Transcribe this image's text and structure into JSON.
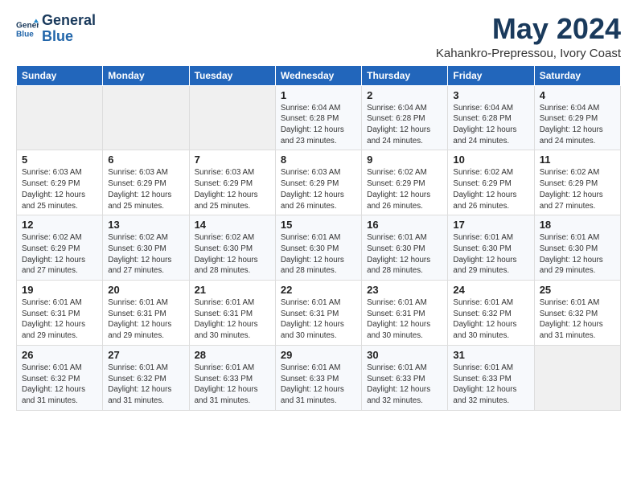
{
  "logo": {
    "line1": "General",
    "line2": "Blue"
  },
  "title": "May 2024",
  "subtitle": "Kahankro-Prepressou, Ivory Coast",
  "weekdays": [
    "Sunday",
    "Monday",
    "Tuesday",
    "Wednesday",
    "Thursday",
    "Friday",
    "Saturday"
  ],
  "weeks": [
    [
      {
        "day": "",
        "info": ""
      },
      {
        "day": "",
        "info": ""
      },
      {
        "day": "",
        "info": ""
      },
      {
        "day": "1",
        "info": "Sunrise: 6:04 AM\nSunset: 6:28 PM\nDaylight: 12 hours\nand 23 minutes."
      },
      {
        "day": "2",
        "info": "Sunrise: 6:04 AM\nSunset: 6:28 PM\nDaylight: 12 hours\nand 24 minutes."
      },
      {
        "day": "3",
        "info": "Sunrise: 6:04 AM\nSunset: 6:28 PM\nDaylight: 12 hours\nand 24 minutes."
      },
      {
        "day": "4",
        "info": "Sunrise: 6:04 AM\nSunset: 6:29 PM\nDaylight: 12 hours\nand 24 minutes."
      }
    ],
    [
      {
        "day": "5",
        "info": "Sunrise: 6:03 AM\nSunset: 6:29 PM\nDaylight: 12 hours\nand 25 minutes."
      },
      {
        "day": "6",
        "info": "Sunrise: 6:03 AM\nSunset: 6:29 PM\nDaylight: 12 hours\nand 25 minutes."
      },
      {
        "day": "7",
        "info": "Sunrise: 6:03 AM\nSunset: 6:29 PM\nDaylight: 12 hours\nand 25 minutes."
      },
      {
        "day": "8",
        "info": "Sunrise: 6:03 AM\nSunset: 6:29 PM\nDaylight: 12 hours\nand 26 minutes."
      },
      {
        "day": "9",
        "info": "Sunrise: 6:02 AM\nSunset: 6:29 PM\nDaylight: 12 hours\nand 26 minutes."
      },
      {
        "day": "10",
        "info": "Sunrise: 6:02 AM\nSunset: 6:29 PM\nDaylight: 12 hours\nand 26 minutes."
      },
      {
        "day": "11",
        "info": "Sunrise: 6:02 AM\nSunset: 6:29 PM\nDaylight: 12 hours\nand 27 minutes."
      }
    ],
    [
      {
        "day": "12",
        "info": "Sunrise: 6:02 AM\nSunset: 6:29 PM\nDaylight: 12 hours\nand 27 minutes."
      },
      {
        "day": "13",
        "info": "Sunrise: 6:02 AM\nSunset: 6:30 PM\nDaylight: 12 hours\nand 27 minutes."
      },
      {
        "day": "14",
        "info": "Sunrise: 6:02 AM\nSunset: 6:30 PM\nDaylight: 12 hours\nand 28 minutes."
      },
      {
        "day": "15",
        "info": "Sunrise: 6:01 AM\nSunset: 6:30 PM\nDaylight: 12 hours\nand 28 minutes."
      },
      {
        "day": "16",
        "info": "Sunrise: 6:01 AM\nSunset: 6:30 PM\nDaylight: 12 hours\nand 28 minutes."
      },
      {
        "day": "17",
        "info": "Sunrise: 6:01 AM\nSunset: 6:30 PM\nDaylight: 12 hours\nand 29 minutes."
      },
      {
        "day": "18",
        "info": "Sunrise: 6:01 AM\nSunset: 6:30 PM\nDaylight: 12 hours\nand 29 minutes."
      }
    ],
    [
      {
        "day": "19",
        "info": "Sunrise: 6:01 AM\nSunset: 6:31 PM\nDaylight: 12 hours\nand 29 minutes."
      },
      {
        "day": "20",
        "info": "Sunrise: 6:01 AM\nSunset: 6:31 PM\nDaylight: 12 hours\nand 29 minutes."
      },
      {
        "day": "21",
        "info": "Sunrise: 6:01 AM\nSunset: 6:31 PM\nDaylight: 12 hours\nand 30 minutes."
      },
      {
        "day": "22",
        "info": "Sunrise: 6:01 AM\nSunset: 6:31 PM\nDaylight: 12 hours\nand 30 minutes."
      },
      {
        "day": "23",
        "info": "Sunrise: 6:01 AM\nSunset: 6:31 PM\nDaylight: 12 hours\nand 30 minutes."
      },
      {
        "day": "24",
        "info": "Sunrise: 6:01 AM\nSunset: 6:32 PM\nDaylight: 12 hours\nand 30 minutes."
      },
      {
        "day": "25",
        "info": "Sunrise: 6:01 AM\nSunset: 6:32 PM\nDaylight: 12 hours\nand 31 minutes."
      }
    ],
    [
      {
        "day": "26",
        "info": "Sunrise: 6:01 AM\nSunset: 6:32 PM\nDaylight: 12 hours\nand 31 minutes."
      },
      {
        "day": "27",
        "info": "Sunrise: 6:01 AM\nSunset: 6:32 PM\nDaylight: 12 hours\nand 31 minutes."
      },
      {
        "day": "28",
        "info": "Sunrise: 6:01 AM\nSunset: 6:33 PM\nDaylight: 12 hours\nand 31 minutes."
      },
      {
        "day": "29",
        "info": "Sunrise: 6:01 AM\nSunset: 6:33 PM\nDaylight: 12 hours\nand 31 minutes."
      },
      {
        "day": "30",
        "info": "Sunrise: 6:01 AM\nSunset: 6:33 PM\nDaylight: 12 hours\nand 32 minutes."
      },
      {
        "day": "31",
        "info": "Sunrise: 6:01 AM\nSunset: 6:33 PM\nDaylight: 12 hours\nand 32 minutes."
      },
      {
        "day": "",
        "info": ""
      }
    ]
  ]
}
